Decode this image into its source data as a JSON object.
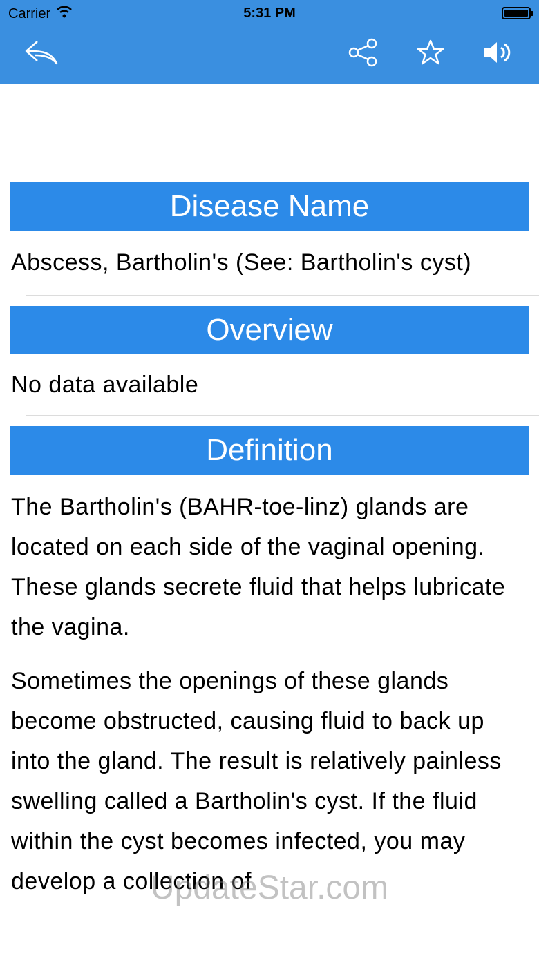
{
  "status_bar": {
    "carrier": "Carrier",
    "time": "5:31 PM"
  },
  "nav": {
    "icons": [
      "reply-back-icon",
      "share-icon",
      "star-icon",
      "speaker-icon"
    ]
  },
  "sections": {
    "disease_name": {
      "title": "Disease Name",
      "text": "Abscess, Bartholin's (See: Bartholin's cyst)"
    },
    "overview": {
      "title": "Overview",
      "text": "No data available"
    },
    "definition": {
      "title": "Definition",
      "p1": "The Bartholin's (BAHR-toe-linz) glands are located on each side of the vaginal opening. These glands secrete fluid that helps lubricate the vagina.",
      "p2": "Sometimes the openings of these glands become obstructed, causing fluid to back up into the gland. The result is relatively painless swelling called a Bartholin's cyst. If the fluid within the cyst becomes infected, you may develop a collection of"
    }
  },
  "watermark": "UpdateStar.com",
  "colors": {
    "nav_bar": "#3a8fe0",
    "section_header": "#2c8ae8"
  }
}
